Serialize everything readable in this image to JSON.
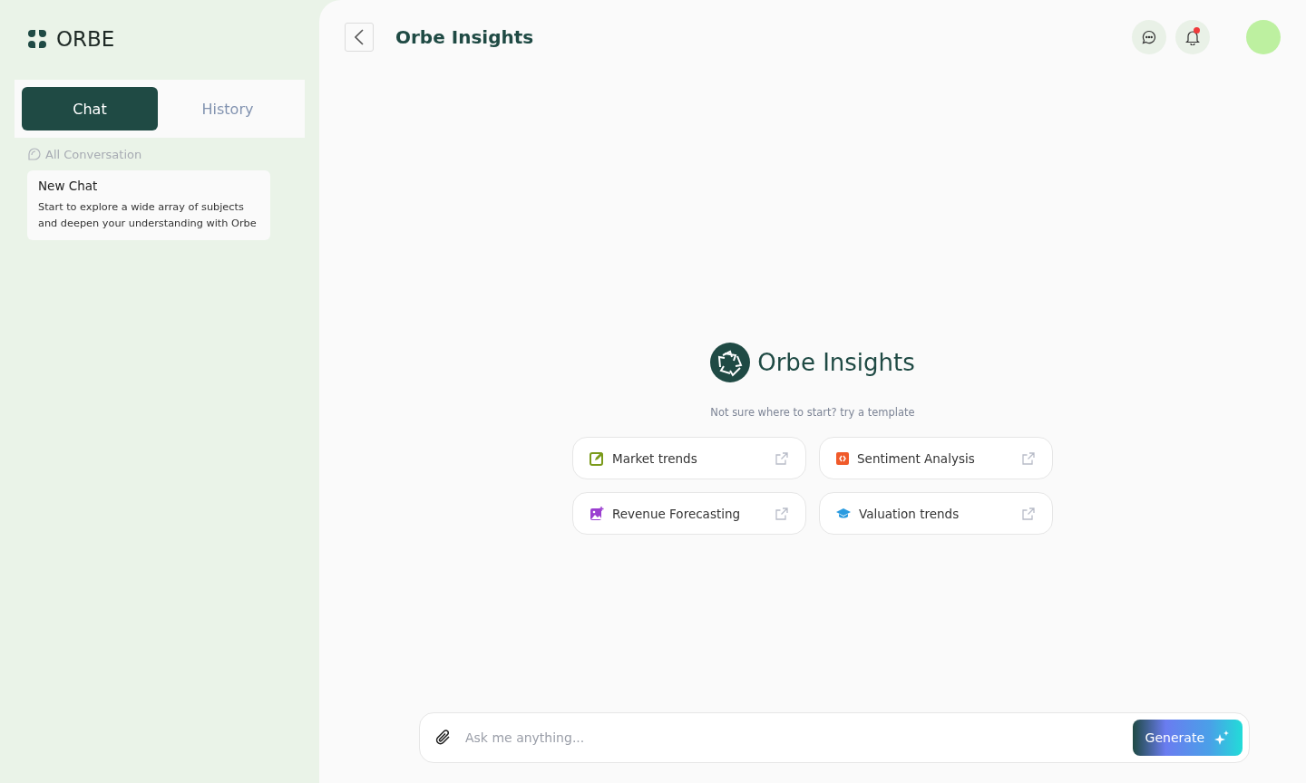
{
  "brand": {
    "name": "ORBE"
  },
  "tabs": [
    {
      "label": "Chat",
      "selected": true
    },
    {
      "label": "History",
      "selected": false
    }
  ],
  "sidebar": {
    "section_label": "All Conversation",
    "conversations": [
      {
        "title": "New Chat",
        "snippet": "Start to explore a wide array of subjects and deepen your understanding with Orbe"
      }
    ]
  },
  "header": {
    "title": "Orbe Insights",
    "notification_unread": true
  },
  "hero": {
    "title": "Orbe Insights",
    "subtitle": "Not sure where to start? try a template"
  },
  "templates": [
    {
      "label": "Market trends",
      "kind": "edit"
    },
    {
      "label": "Sentiment Analysis",
      "kind": "code"
    },
    {
      "label": "Revenue Forecasting",
      "kind": "image"
    },
    {
      "label": "Valuation trends",
      "kind": "school"
    }
  ],
  "composer": {
    "placeholder": "Ask me anything...",
    "button": "Generate"
  }
}
